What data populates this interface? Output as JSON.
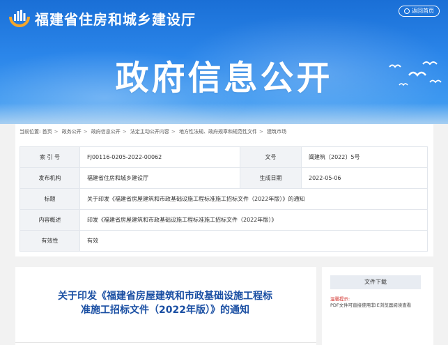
{
  "header": {
    "site_title": "福建省住房和城乡建设厅",
    "home_button": "返回首页",
    "banner_title": "政府信息公开"
  },
  "breadcrumb": {
    "prefix": "当前位置:",
    "items": [
      "首页",
      "政务公开",
      "政府信息公开",
      "法定主动公开内容",
      "地方性法规、政府规章和规范性文件",
      "建筑市场"
    ]
  },
  "meta": {
    "index_label": "索 引 号",
    "index_value": "FJ00116-0205-2022-00062",
    "docno_label": "文号",
    "docno_value": "闽建筑〔2022〕5号",
    "publisher_label": "发布机构",
    "publisher_value": "福建省住房和城乡建设厅",
    "date_label": "生成日期",
    "date_value": "2022-05-06",
    "title_label": "标题",
    "title_value": "关于印发《福建省房屋建筑和市政基础设施工程标准施工招标文件（2022年版）》的通知",
    "summary_label": "内容概述",
    "summary_value": "印发《福建省房屋建筑和市政基础设施工程标准施工招标文件（2022年版）》",
    "validity_label": "有效性",
    "validity_value": "有效"
  },
  "article": {
    "title": "关于印发《福建省房屋建筑和市政基础设施工程标准施工招标文件（2022年版）》的通知"
  },
  "sidebar": {
    "download_title": "文件下载",
    "tip_label": "温馨提示:",
    "tip_text": "PDF文件可直接使用非IE浏览器阅读查看"
  },
  "colors": {
    "banner_blue": "#2b86ea",
    "article_title": "#1a4fa3",
    "tip_red": "#d2322d"
  }
}
